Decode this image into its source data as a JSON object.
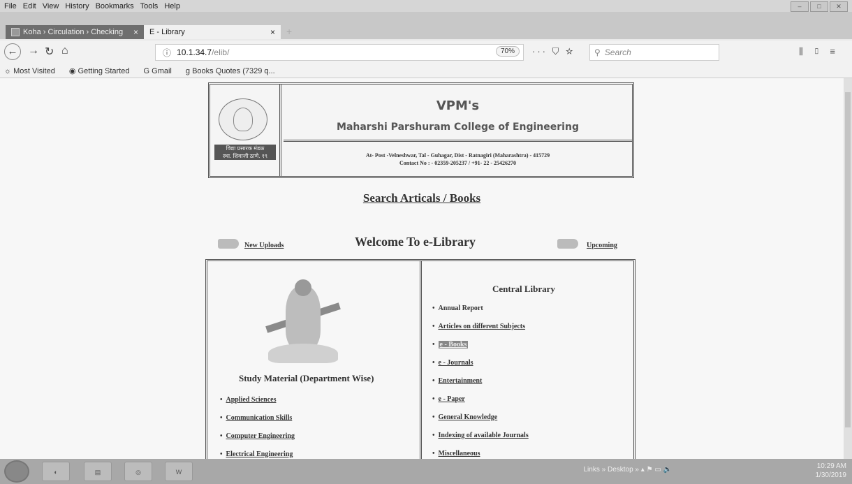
{
  "menu": [
    "File",
    "Edit",
    "View",
    "History",
    "Bookmarks",
    "Tools",
    "Help"
  ],
  "tabs": [
    {
      "title": "Koha › Circulation › Checking",
      "close": "×"
    },
    {
      "title": "E - Library",
      "close": "×"
    }
  ],
  "nav": {
    "url_host": "10.1.34.7",
    "url_path": "/elib/",
    "zoom": "70%",
    "page_actions": "··· ⛉ ☆",
    "search_placeholder": "Search"
  },
  "bookmarks": [
    "Most Visited",
    "Getting Started",
    "Gmail",
    "Books Quotes (7329 q..."
  ],
  "header": {
    "vpm": "VPM's",
    "college": "Maharshi Parshuram College of Engineering",
    "address": "At- Post -Velneshwar, Tal - Guhagar, Dist - Ratnagiri (Maharashtra) - 415729",
    "contact": "Contact No : - 02359-205237 / +91- 22 - 25426270",
    "seal_line1": "विद्या प्रसारक मंडळ",
    "seal_line2": "स्था. शिवाजी ठाणे. १९"
  },
  "search_link": "Search Articals / Books",
  "welcome": "Welcome To e-Library",
  "new_uploads": "New Uploads",
  "upcoming": "Upcoming",
  "study": {
    "title": "Study Material (Department Wise)",
    "items": [
      "Applied Sciences",
      "Communication Skills",
      "Computer Engineering",
      "Electrical Engineering"
    ]
  },
  "central": {
    "title": "Central Library",
    "items": [
      "Annual Report",
      "Articles on different Subjects",
      "e - Books",
      "e - Journals",
      "Entertainment",
      "e - Paper",
      "General Knowledge",
      "Indexing of available Journals",
      "Miscellaneous"
    ]
  },
  "tray": {
    "links": "Links",
    "desktop": "Desktop",
    "time": "10:29 AM",
    "date": "1/30/2019"
  }
}
